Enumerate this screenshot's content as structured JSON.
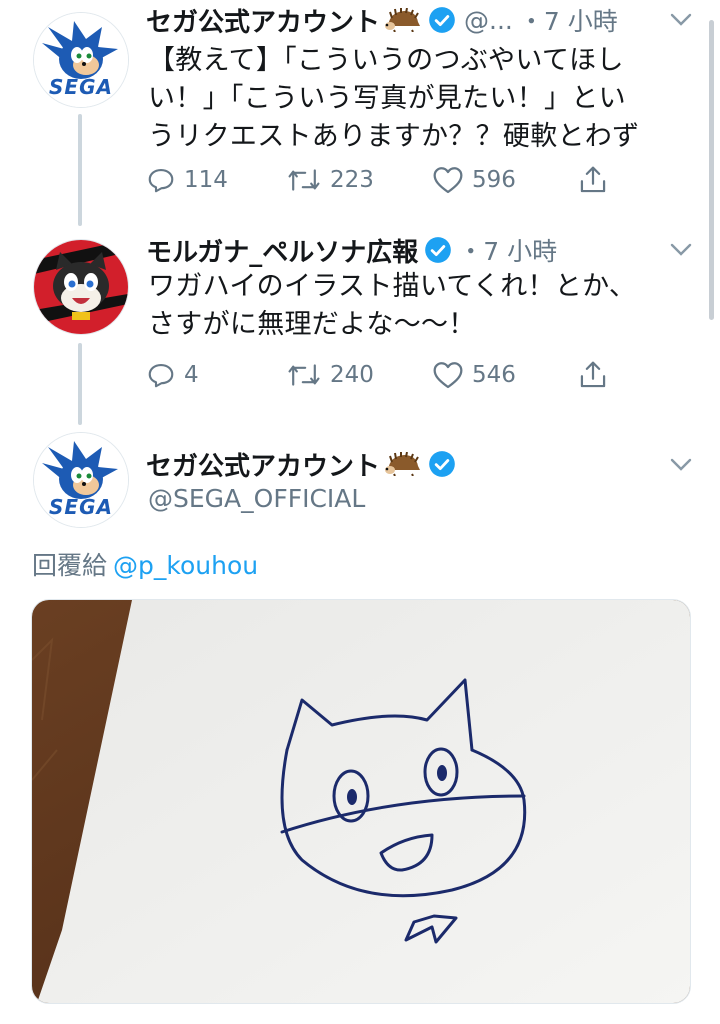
{
  "tweets": [
    {
      "display_name": "セガ公式アカウント",
      "handle_short": "@...",
      "time": "・7 小時",
      "text_lines": [
        "【教えて】「こういうのつぶやいてほし",
        "い！」「こういう写真が見たい！」とい",
        "うリクエストありますか？？硬軟とわず"
      ],
      "replies": "114",
      "retweets": "223",
      "likes": "596"
    },
    {
      "display_name": "モルガナ_ペルソナ広報",
      "time": "・7 小時",
      "text_lines": [
        "ワガハイのイラスト描いてくれ！とか、",
        "さすがに無理だよな〜〜！"
      ],
      "replies": "4",
      "retweets": "240",
      "likes": "546"
    }
  ],
  "focused_tweet": {
    "display_name": "セガ公式アカウント",
    "handle": "@SEGA_OFFICIAL",
    "reply_prefix": "回覆給",
    "reply_target": "@p_kouhou",
    "photo_alt": "hand-drawn cat sketch"
  },
  "avatar_logo_text": "SEGA",
  "icons": {
    "reply": "reply-icon",
    "retweet": "retweet-icon",
    "like": "like-icon",
    "share": "share-icon",
    "verified": "verified-badge-icon",
    "caret": "chevron-down-icon"
  },
  "colors": {
    "text": "#14171a",
    "secondary": "#657786",
    "link": "#1da1f2",
    "thread_line": "#ccd6dd",
    "sega_blue": "#1d5bb4"
  }
}
